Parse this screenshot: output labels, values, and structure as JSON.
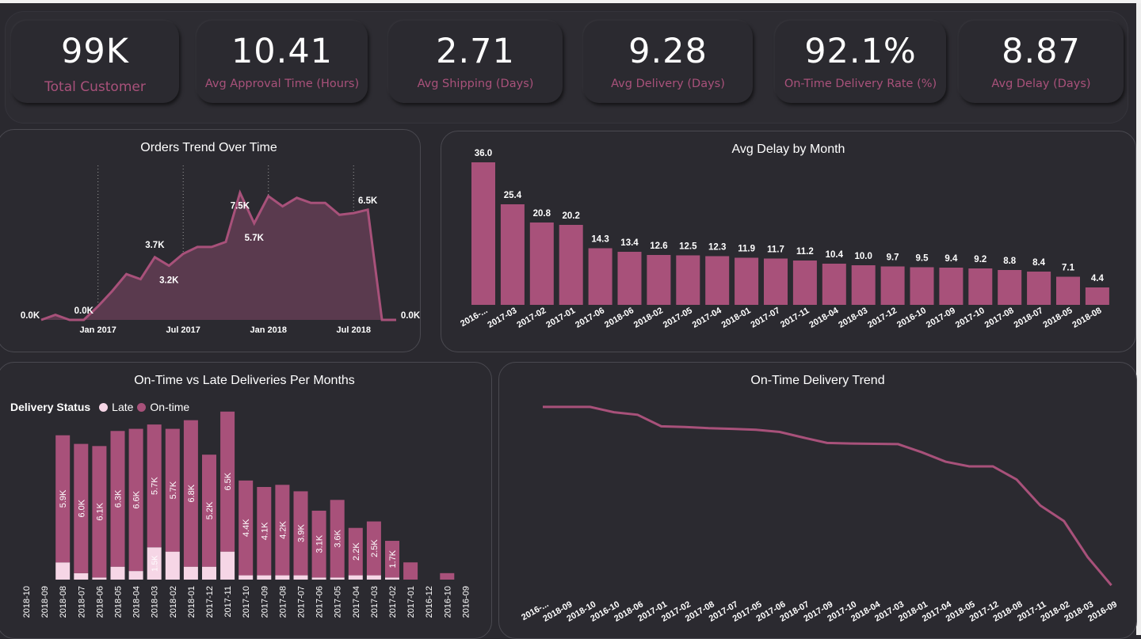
{
  "kpis": [
    {
      "value": "99K",
      "label": "Total Customer"
    },
    {
      "value": "10.41",
      "label": "Avg Approval Time (Hours)"
    },
    {
      "value": "2.71",
      "label": "Avg Shipping (Days)"
    },
    {
      "value": "9.28",
      "label": "Avg Delivery (Days)"
    },
    {
      "value": "92.1%",
      "label": "On-Time Delivery Rate (%)"
    },
    {
      "value": "8.87",
      "label": "Avg Delay (Days)"
    }
  ],
  "colors": {
    "accent": "#a8517a",
    "late": "#f6d6e6",
    "area_fill": "#5a3a4e",
    "background": "#2a292f",
    "panel": "#2b2a30"
  },
  "chart_data": [
    {
      "id": "orders_trend",
      "type": "area",
      "title": "Orders Trend Over Time",
      "x": [
        "2016-09",
        "2016-10",
        "2016-11",
        "2016-12",
        "2017-01",
        "2017-02",
        "2017-03",
        "2017-04",
        "2017-05",
        "2017-06",
        "2017-07",
        "2017-08",
        "2017-09",
        "2017-10",
        "2017-11",
        "2017-12",
        "2018-01",
        "2018-02",
        "2018-03",
        "2018-04",
        "2018-05",
        "2018-06",
        "2018-07",
        "2018-08",
        "2018-09",
        "2018-10"
      ],
      "values": [
        0.0,
        0.3,
        0.0,
        0.0,
        0.8,
        1.7,
        2.7,
        2.4,
        3.7,
        3.2,
        3.9,
        4.3,
        4.3,
        4.6,
        7.5,
        5.7,
        7.3,
        6.7,
        7.2,
        6.9,
        6.9,
        6.2,
        6.3,
        6.5,
        0.0,
        0.0
      ],
      "unit": "K",
      "data_labels": [
        {
          "x": "2016-09",
          "label": "0.0K"
        },
        {
          "x": "2016-12",
          "label": "0.0K"
        },
        {
          "x": "2017-05",
          "label": "3.7K"
        },
        {
          "x": "2017-06",
          "label": "3.2K"
        },
        {
          "x": "2017-11",
          "label": "7.5K"
        },
        {
          "x": "2017-12",
          "label": "5.7K"
        },
        {
          "x": "2018-08",
          "label": "6.5K"
        },
        {
          "x": "2018-10",
          "label": "0.0K"
        }
      ],
      "x_ticks": [
        "Jan 2017",
        "Jul 2017",
        "Jan 2018",
        "Jul 2018"
      ],
      "ylim": [
        0,
        8.5
      ],
      "grid": false
    },
    {
      "id": "avg_delay_by_month",
      "type": "bar",
      "title": "Avg Delay by Month",
      "categories": [
        "2016-...",
        "2017-03",
        "2017-02",
        "2017-01",
        "2017-06",
        "2018-06",
        "2018-02",
        "2017-05",
        "2017-04",
        "2018-01",
        "2017-07",
        "2017-11",
        "2018-04",
        "2018-03",
        "2017-12",
        "2016-10",
        "2017-09",
        "2017-10",
        "2017-08",
        "2018-07",
        "2018-05",
        "2018-08"
      ],
      "values": [
        36.0,
        25.4,
        20.8,
        20.2,
        14.3,
        13.4,
        12.6,
        12.5,
        12.3,
        11.9,
        11.7,
        11.2,
        10.4,
        10.0,
        9.7,
        9.5,
        9.4,
        9.2,
        8.8,
        8.4,
        7.1,
        4.4
      ],
      "labels": [
        "36.0",
        "25.4",
        "20.8",
        "20.2",
        "14.3",
        "13.4",
        "12.6",
        "12.5",
        "12.3",
        "11.9",
        "11.7",
        "11.2",
        "10.4",
        "10.0",
        "9.7",
        "9.5",
        "9.4",
        "9.2",
        "8.8",
        "8.4",
        "7.1",
        "4.4"
      ],
      "ylim": [
        0,
        40
      ]
    },
    {
      "id": "ontime_vs_late",
      "type": "bar",
      "stacked": true,
      "title": "On-Time vs Late Deliveries Per Months",
      "legend_title": "Delivery Status",
      "categories": [
        "2018-10",
        "2018-09",
        "2018-08",
        "2018-07",
        "2018-06",
        "2018-05",
        "2018-04",
        "2018-03",
        "2018-02",
        "2018-01",
        "2017-12",
        "2017-11",
        "2017-10",
        "2017-09",
        "2017-08",
        "2017-07",
        "2017-06",
        "2017-05",
        "2017-04",
        "2017-03",
        "2017-02",
        "2017-01",
        "2016-12",
        "2016-10",
        "2016-09"
      ],
      "series": [
        {
          "name": "Late",
          "values": [
            0,
            0,
            0.8,
            0.3,
            0.1,
            0.6,
            0.4,
            1.5,
            1.3,
            0.6,
            0.6,
            1.3,
            0.2,
            0.2,
            0.2,
            0.2,
            0.1,
            0.1,
            0.2,
            0.2,
            0.1,
            0.0,
            0.0,
            0.0,
            0.0
          ],
          "labels": [
            "",
            "",
            "",
            "",
            "",
            "",
            "",
            "1.5K",
            "",
            "",
            "",
            "",
            "",
            "",
            "",
            "",
            "",
            "",
            "",
            "",
            "",
            "",
            "",
            "",
            ""
          ]
        },
        {
          "name": "On-time",
          "values": [
            0,
            0,
            5.9,
            6.0,
            6.1,
            6.3,
            6.6,
            5.7,
            5.7,
            6.8,
            5.2,
            6.5,
            4.4,
            4.1,
            4.2,
            3.9,
            3.1,
            3.6,
            2.2,
            2.5,
            1.7,
            0.8,
            0.0,
            0.3,
            0.0
          ],
          "labels": [
            "",
            "",
            "5.9K",
            "6.0K",
            "6.1K",
            "6.3K",
            "6.6K",
            "5.7K",
            "5.7K",
            "6.8K",
            "5.2K",
            "6.5K",
            "4.4K",
            "4.1K",
            "4.2K",
            "3.9K",
            "3.1K",
            "3.6K",
            "2.2K",
            "2.5K",
            "1.7K",
            "",
            "",
            "",
            ""
          ]
        }
      ],
      "ylim": [
        0,
        8
      ]
    },
    {
      "id": "ontime_trend",
      "type": "line",
      "title": "On-Time Delivery Trend",
      "categories": [
        "2016-...",
        "2018-09",
        "2018-10",
        "2016-10",
        "2018-06",
        "2017-01",
        "2017-02",
        "2017-08",
        "2017-07",
        "2017-05",
        "2017-06",
        "2018-07",
        "2017-09",
        "2017-10",
        "2018-04",
        "2017-03",
        "2018-01",
        "2017-04",
        "2018-05",
        "2017-12",
        "2018-08",
        "2017-11",
        "2018-02",
        "2018-03",
        "2016-09"
      ],
      "values": [
        100,
        100,
        100,
        98.3,
        97.5,
        93.8,
        93.6,
        93.2,
        93.0,
        92.7,
        92.0,
        90.2,
        88.5,
        88.3,
        88.2,
        88.1,
        85.5,
        82.5,
        81.0,
        81.0,
        76.8,
        68.5,
        63.5,
        52.0,
        43.0
      ],
      "ylim": [
        40,
        102
      ]
    }
  ]
}
